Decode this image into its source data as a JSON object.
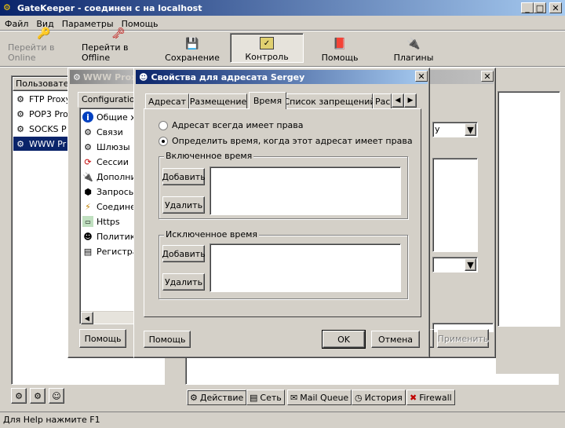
{
  "app": {
    "title": "GateKeeper - соединен с на localhost",
    "menu": [
      "Файл",
      "Вид",
      "Параметры",
      "Помощь"
    ],
    "toolbar": [
      {
        "label": "Перейти в Online",
        "icon": "key-icon",
        "disabled": true
      },
      {
        "label": "Перейти в Offline",
        "icon": "key-red-icon"
      },
      {
        "label": "Сохранение",
        "icon": "floppy-icon"
      },
      {
        "label": "Контроль",
        "icon": "monitor-icon",
        "pressed": true
      },
      {
        "label": "Помощь",
        "icon": "help-book-icon"
      },
      {
        "label": "Плагины",
        "icon": "plug-icon"
      }
    ],
    "status": "Для Help нажмите F1"
  },
  "left_panel": {
    "header": "Пользовател",
    "items": [
      "FTP Proxy",
      "POP3 Pro",
      "SOCKS P",
      "WWW Pr"
    ],
    "selected": 3
  },
  "bottom_tabs": [
    "Действие",
    "Сеть",
    "Mail Queue",
    "История",
    "Firewall"
  ],
  "proxy_window": {
    "title": "WWW Prox",
    "tab": "Configuration",
    "items": [
      "Общие x",
      "Связи",
      "Шлюзы",
      "Сессии",
      "Дополни",
      "Запросы",
      "Соедине",
      "Https",
      "Политики",
      "Регистра"
    ],
    "help_button": "Помощь"
  },
  "back_dialog": {
    "apply_button": "Применить",
    "dropdown_suffix": "y"
  },
  "dialog": {
    "title": "Свойства для адресата Sergey",
    "tabs": [
      "Адресат",
      "Размещение",
      "Время",
      "Список запрещений",
      "Рас"
    ],
    "active_tab": 2,
    "radio1": "Адресат всегда имеет права",
    "radio2": "Определить время, когда этот адресат имеет права",
    "selected_radio": 2,
    "group_included": "Включенное время",
    "group_excluded": "Исключенное время",
    "add_button": "Добавить",
    "remove_button": "Удалить",
    "help_button": "Помощь",
    "ok_button": "OK",
    "cancel_button": "Отмена"
  }
}
